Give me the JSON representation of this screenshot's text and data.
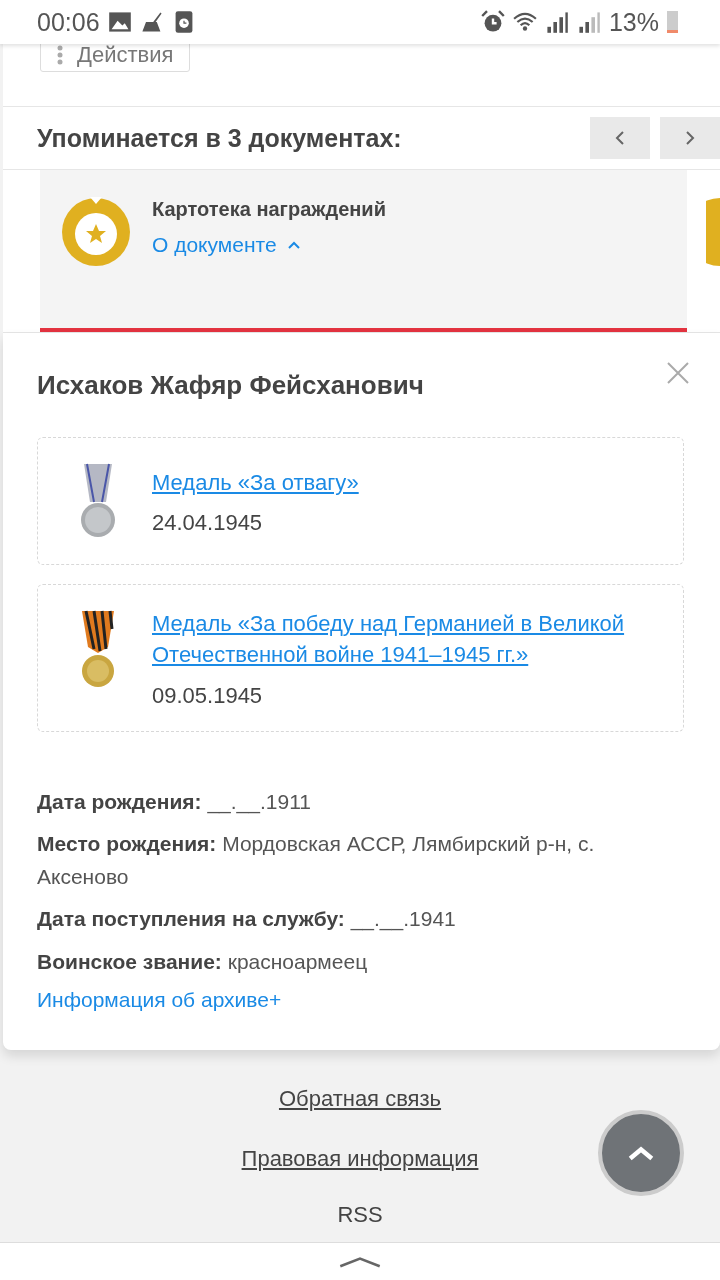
{
  "status_bar": {
    "time": "00:06",
    "battery": "13%"
  },
  "actions_button": "Действия",
  "mentions": {
    "title": "Упоминается в 3 документах:",
    "documents": [
      {
        "title": "Картотека награждений",
        "link": "О документе",
        "expanded": true,
        "selected": true
      }
    ]
  },
  "person": {
    "name": "Исхаков Жафяр Фейсханович",
    "awards": [
      {
        "kind": "bravery",
        "title": "Медаль «За отвагу»",
        "date": "24.04.1945"
      },
      {
        "kind": "victory",
        "title": "Медаль «За победу над Германией в Великой Отечественной войне 1941–1945 гг.»",
        "date": "09.05.1945"
      }
    ],
    "fields": [
      {
        "label": "Дата рождения:",
        "value": "__.__.1911"
      },
      {
        "label": "Место рождения:",
        "value": "Мордовская АССР, Лямбирский р-н, с. Аксеново"
      },
      {
        "label": "Дата поступления на службу:",
        "value": "__.__.1941"
      },
      {
        "label": "Воинское звание:",
        "value": "красноармеец"
      }
    ],
    "archive_link": "Информация об архиве+"
  },
  "footer": {
    "links": [
      "Обратная связь",
      "Правовая информация"
    ],
    "rss": "RSS"
  }
}
